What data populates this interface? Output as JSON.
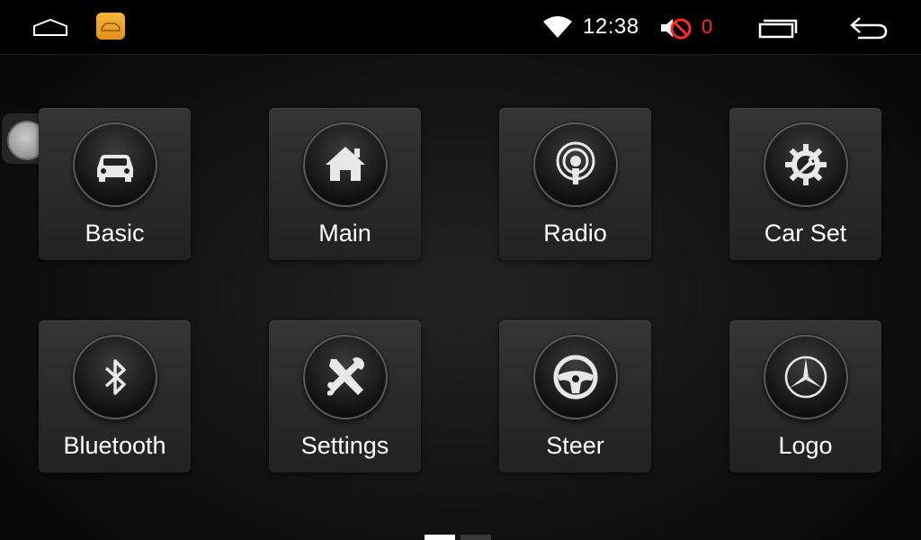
{
  "status_bar": {
    "time": "12:38",
    "volume": "0",
    "colors": {
      "volume_alert": "#ff2a2a",
      "badge": "#f0a52a"
    }
  },
  "tiles": [
    {
      "label": "Basic",
      "icon": "car-icon"
    },
    {
      "label": "Main",
      "icon": "home-icon"
    },
    {
      "label": "Radio",
      "icon": "radio-icon"
    },
    {
      "label": "Car Set",
      "icon": "gear-wrench-icon"
    },
    {
      "label": "Bluetooth",
      "icon": "bluetooth-icon"
    },
    {
      "label": "Settings",
      "icon": "tools-icon"
    },
    {
      "label": "Steer",
      "icon": "steering-wheel-icon"
    },
    {
      "label": "Logo",
      "icon": "mercedes-star-icon"
    }
  ],
  "pager": {
    "pages": 2,
    "current": 1
  }
}
